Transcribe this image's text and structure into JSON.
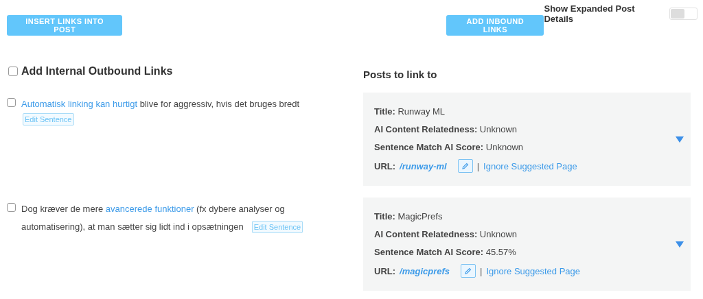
{
  "toggle": {
    "label": "Show Expanded Post Details",
    "on": false
  },
  "buttons": [
    "INSERT LINKS INTO POST",
    "ADD INBOUND LINKS"
  ],
  "outbound": {
    "label": "Add Internal Outbound Links",
    "checked": false
  },
  "posts_heading": "Posts to link to",
  "sentences": [
    {
      "checked": false,
      "parts": [
        {
          "kind": "link",
          "text": "Automatisk linking kan hurtigt"
        },
        {
          "kind": "text",
          "text": " blive for aggressiv, hvis det bruges bredt"
        }
      ],
      "edit": "Edit Sentence"
    },
    {
      "checked": false,
      "parts": [
        {
          "kind": "text",
          "text": "Dog kræver de mere "
        },
        {
          "kind": "link",
          "text": "avancerede funktioner"
        },
        {
          "kind": "text",
          "text": " (fx dybere analyser og automatisering), at man sætter sig lidt ind i opsætningen"
        }
      ],
      "edit": "Edit Sentence"
    }
  ],
  "posts": [
    {
      "fields": [
        {
          "label": "Title:",
          "value": "Runway ML"
        },
        {
          "label": "AI Content Relatedness:",
          "value": "Unknown"
        },
        {
          "label": "Sentence Match AI Score:",
          "value": "Unknown"
        }
      ],
      "url_label": "URL:",
      "url": "/runway-ml",
      "separator": "|",
      "ignore": "Ignore Suggested Page",
      "expanded": false
    },
    {
      "fields": [
        {
          "label": "Title:",
          "value": "MagicPrefs"
        },
        {
          "label": "AI Content Relatedness:",
          "value": "Unknown"
        },
        {
          "label": "Sentence Match AI Score:",
          "value": "45.57%"
        }
      ],
      "url_label": "URL:",
      "url": "/magicprefs",
      "separator": "|",
      "ignore": "Ignore Suggested Page",
      "expanded": false
    }
  ]
}
